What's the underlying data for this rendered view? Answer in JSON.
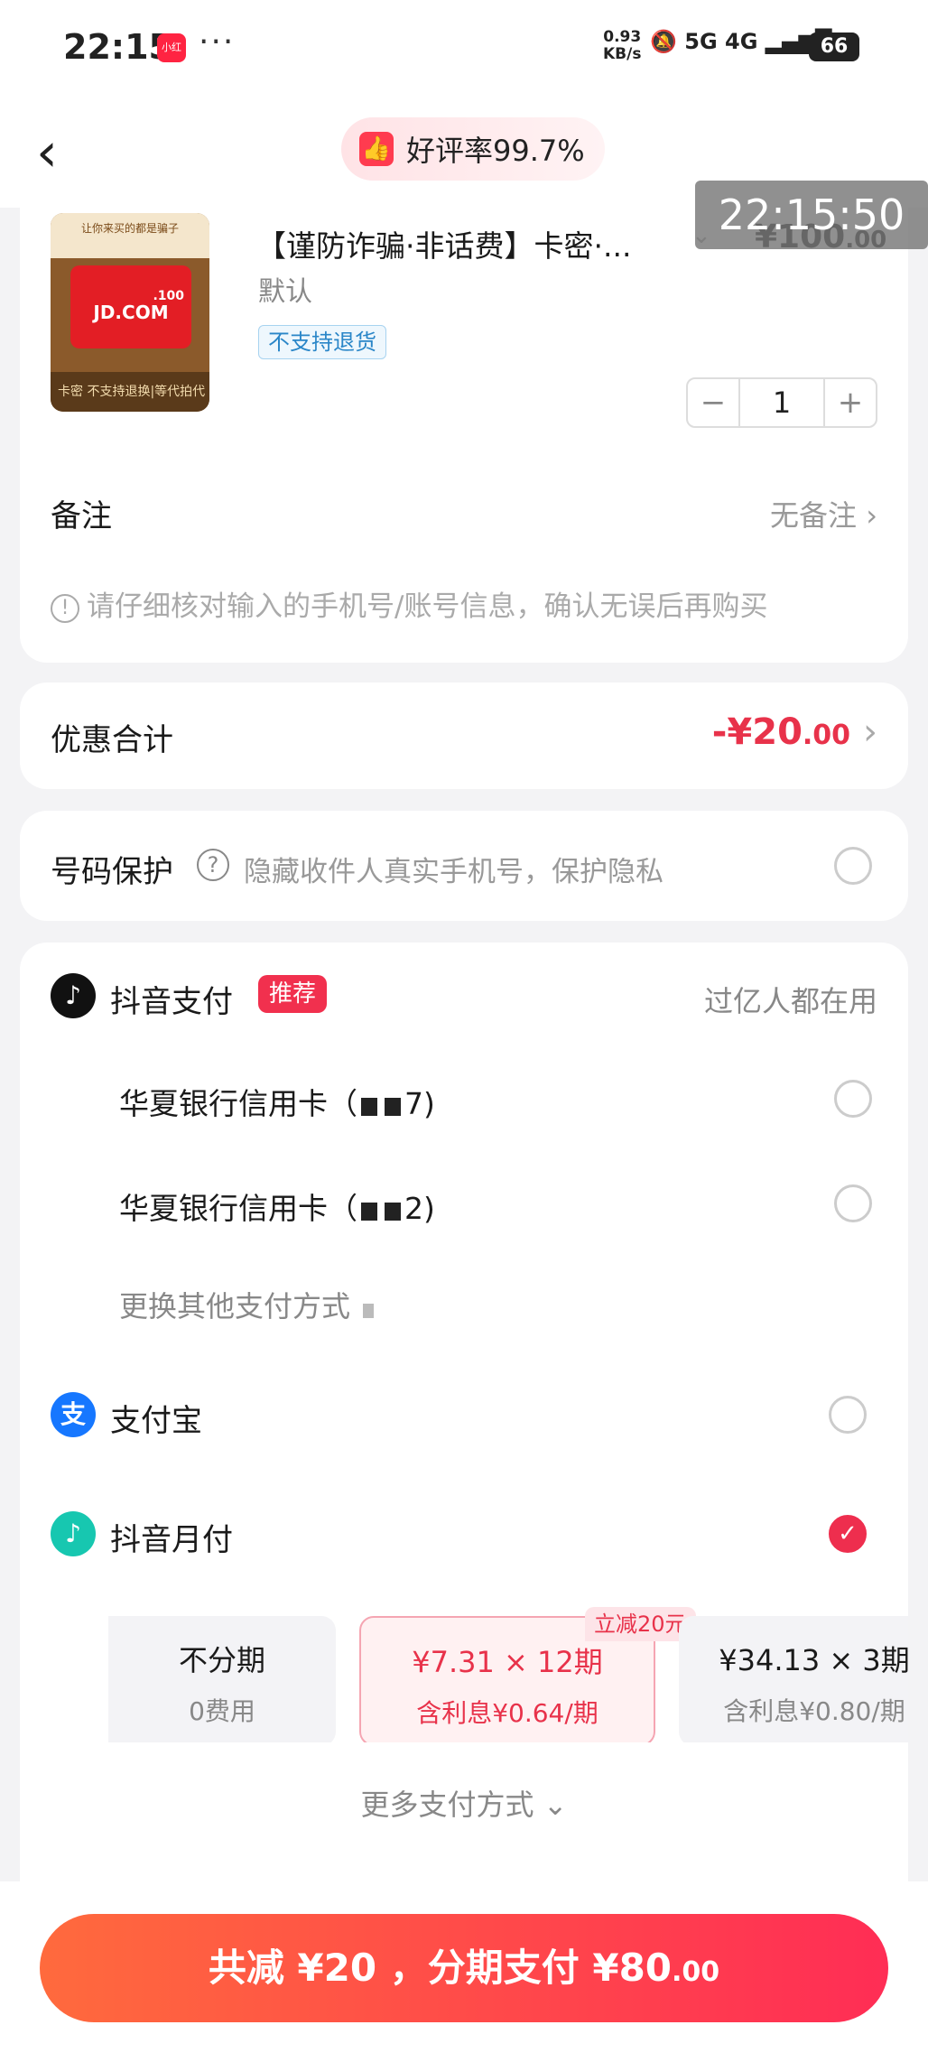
{
  "status_bar": {
    "time": "22:15",
    "app_badge": "小红书",
    "dots": "···",
    "speed_value": "0.93",
    "speed_unit": "KB/s",
    "signals": "5G 4G",
    "battery": "66"
  },
  "nav": {
    "rating_text": "好评率99.7%"
  },
  "overlay_time": "22:15:50",
  "product": {
    "title": "【谨防诈骗·非话费】卡密·...",
    "price_main": "¥100",
    "price_cents": ".00",
    "spec": "默认",
    "tag": "不支持退货",
    "quantity": "1",
    "image_top_text": "让你来买的都是骗子",
    "image_brand": "JD.COM",
    "image_amount": ".100",
    "image_bottom_text": "卡密 不支持退换|等代拍代付",
    "remark_label": "备注",
    "remark_value": "无备注",
    "warning": "请仔细核对输入的手机号/账号信息，确认无误后再购买"
  },
  "discount": {
    "label": "优惠合计",
    "value_main": "-¥20",
    "value_cents": ".00"
  },
  "privacy": {
    "label": "号码保护",
    "desc": "隐藏收件人真实手机号，保护隐私"
  },
  "payment": {
    "douyin_pay": "抖音支付",
    "recommend_badge": "推荐",
    "douyin_note": "过亿人都在用",
    "card1_prefix": "华夏银行信用卡（",
    "card1_suffix": "7)",
    "card2_prefix": "华夏银行信用卡（",
    "card2_suffix": "2)",
    "other_methods": "更换其他支付方式",
    "alipay": "支付宝",
    "douyin_monthly": "抖音月付",
    "plans": [
      {
        "line1": "不分期",
        "line2": "0费用"
      },
      {
        "line1": "¥7.31 × 12期",
        "line2": "含利息¥0.64/期"
      },
      {
        "line1": "¥34.13 × 3期",
        "line2": "含利息¥0.80/期"
      }
    ],
    "plan_tag": "立减20元",
    "more_methods": "更多支付方式"
  },
  "bottom": {
    "btn_main": "共减 ¥20 ，分期支付 ¥80",
    "btn_cents": ".00"
  },
  "colors": {
    "accent_red": "#e8324a",
    "button_gradient_start": "#ff6a3d",
    "button_gradient_end": "#ff2d55",
    "alipay_blue": "#1677ff"
  }
}
